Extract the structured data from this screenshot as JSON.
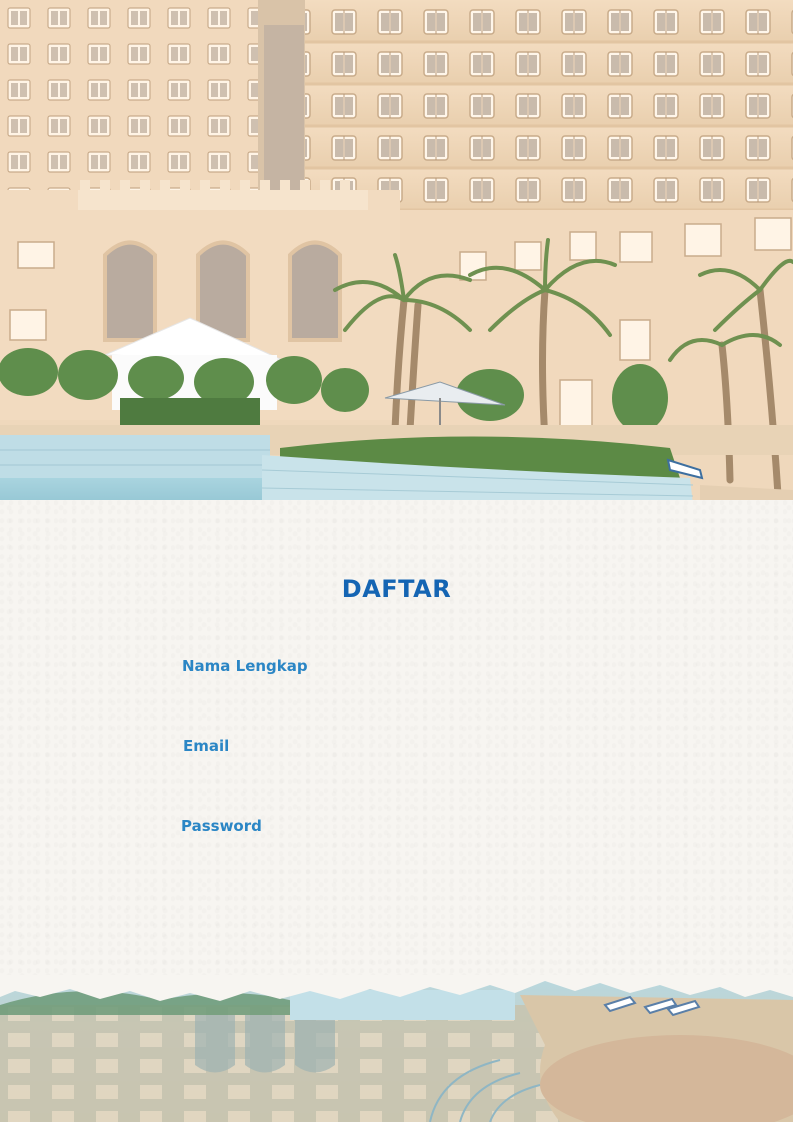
{
  "form": {
    "title": "DAFTAR",
    "fields": [
      {
        "label": "Nama Lengkap",
        "value": ""
      },
      {
        "label": "Email",
        "value": ""
      },
      {
        "label": "Password",
        "value": ""
      }
    ]
  },
  "colors": {
    "title": "#1565b3",
    "label": "#2b86c5",
    "paper": "#f7f5f1"
  }
}
